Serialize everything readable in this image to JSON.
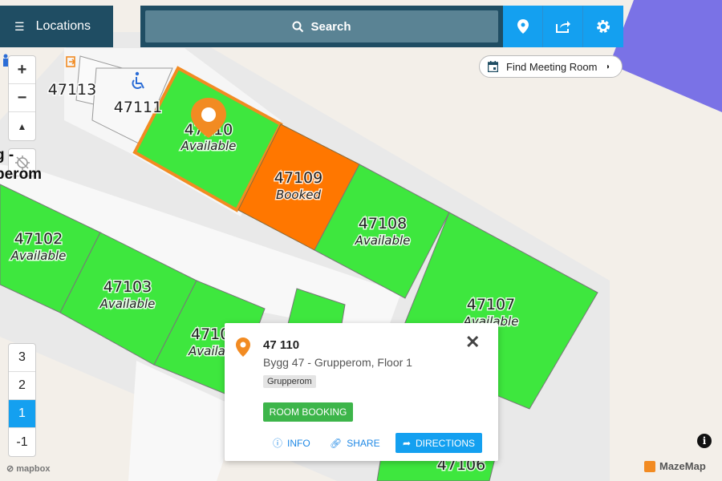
{
  "header": {
    "locations_label": "Locations",
    "search_label": "Search"
  },
  "meeting": {
    "label": "Find Meeting Room"
  },
  "zoom": {
    "in": "+",
    "out": "−"
  },
  "building_label_line1": "g -",
  "building_label_line2": "perom",
  "rooms": [
    {
      "id": "47110",
      "status": "Available",
      "shown_number": "47110"
    },
    {
      "id": "47109",
      "status": "Booked"
    },
    {
      "id": "47108",
      "status": "Available"
    },
    {
      "id": "47102",
      "status": "Available"
    },
    {
      "id": "47103",
      "status": "Available"
    },
    {
      "id": "47107",
      "status": "Available"
    },
    {
      "id": "4710",
      "status": "Availa"
    },
    {
      "id": "47113"
    },
    {
      "id": "47111"
    },
    {
      "id": "47106"
    }
  ],
  "floors": [
    "3",
    "2",
    "1",
    "-1"
  ],
  "active_floor": "1",
  "popup": {
    "title": "47 110",
    "subtitle": "Bygg 47 - Grupperom, Floor 1",
    "tag": "Grupperom",
    "room_booking": "ROOM BOOKING",
    "info": "INFO",
    "share": "SHARE",
    "directions": "DIRECTIONS"
  },
  "attribution": {
    "mapbox": "mapbox",
    "mazemap": "MazeMap",
    "info": "i"
  },
  "colors": {
    "available": "#3ee73e",
    "booked": "#ff7700",
    "selected_outline": "#f28b22",
    "header": "#1f4d63",
    "accent": "#14a0f0"
  }
}
